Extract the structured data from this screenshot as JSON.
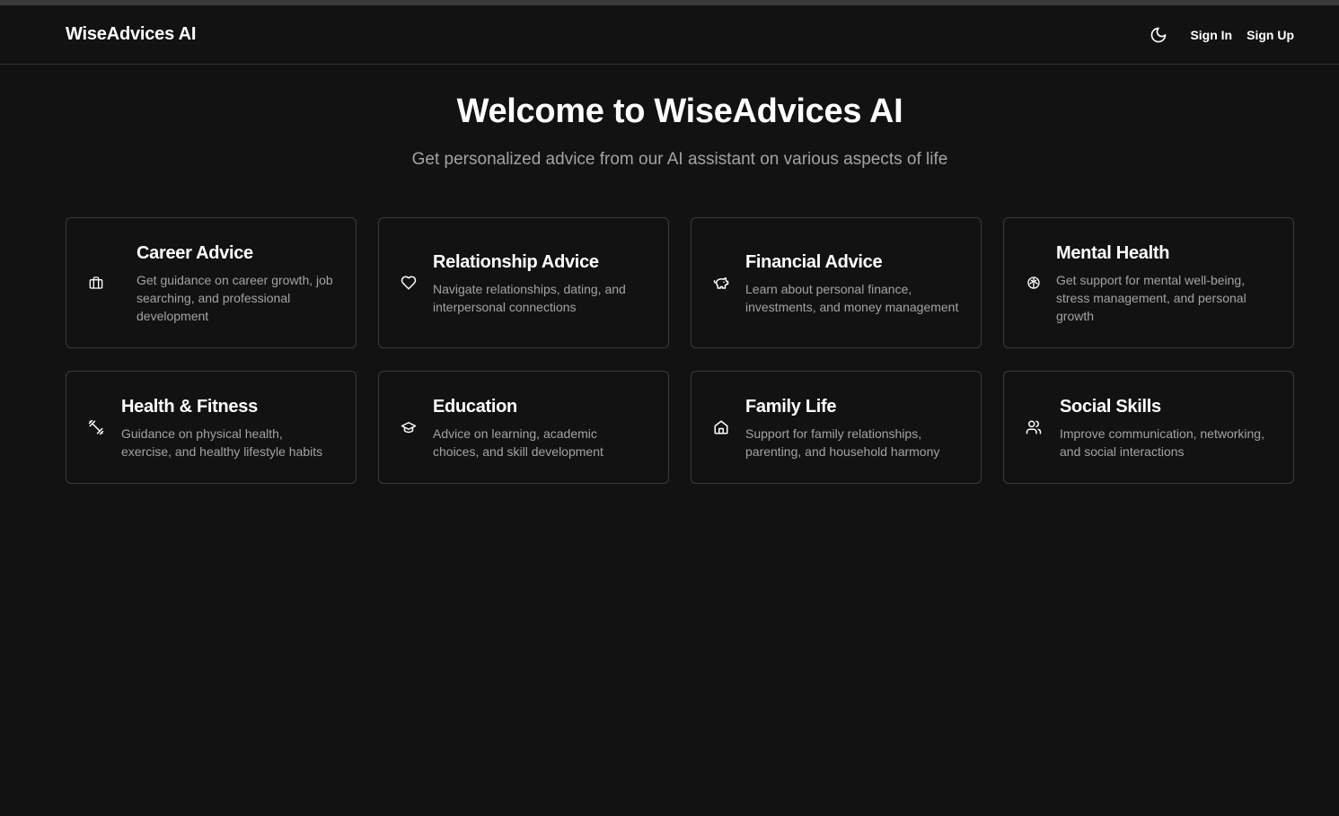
{
  "header": {
    "brand": "WiseAdvices AI",
    "theme_icon": "moon-icon",
    "sign_in": "Sign In",
    "sign_up": "Sign Up"
  },
  "hero": {
    "title": "Welcome to WiseAdvices AI",
    "subtitle": "Get personalized advice from our AI assistant on various aspects of life"
  },
  "categories": [
    {
      "title": "Career Advice",
      "description": "Get guidance on career growth, job searching, and professional development",
      "icon": "briefcase-icon"
    },
    {
      "title": "Relationship Advice",
      "description": "Navigate relationships, dating, and interpersonal connections",
      "icon": "heart-icon"
    },
    {
      "title": "Financial Advice",
      "description": "Learn about personal finance, investments, and money management",
      "icon": "piggy-bank-icon"
    },
    {
      "title": "Mental Health",
      "description": "Get support for mental well-being, stress management, and personal growth",
      "icon": "brain-icon"
    },
    {
      "title": "Health & Fitness",
      "description": "Guidance on physical health, exercise, and healthy lifestyle habits",
      "icon": "dumbbell-icon"
    },
    {
      "title": "Education",
      "description": "Advice on learning, academic choices, and skill development",
      "icon": "graduation-cap-icon"
    },
    {
      "title": "Family Life",
      "description": "Support for family relationships, parenting, and household harmony",
      "icon": "home-icon"
    },
    {
      "title": "Social Skills",
      "description": "Improve communication, networking, and social interactions",
      "icon": "users-icon"
    }
  ],
  "colors": {
    "background": "#121212",
    "border": "#3a3a3a",
    "muted_text": "#a3a3a3",
    "text": "#ffffff"
  }
}
